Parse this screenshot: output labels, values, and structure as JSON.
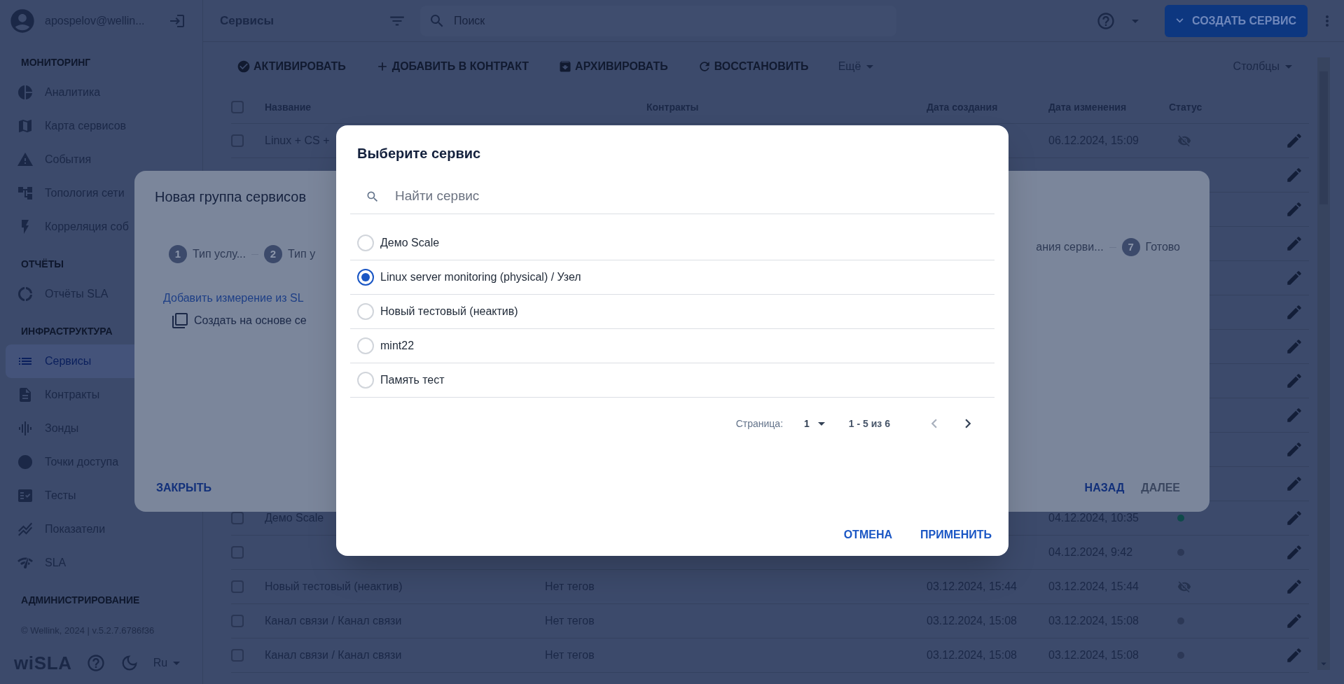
{
  "sidebar": {
    "user": "apospelov@wellin...",
    "sections": [
      {
        "title": "МОНИТОРИНГ",
        "items": [
          {
            "label": "Аналитика",
            "selected": false
          },
          {
            "label": "Карта сервисов",
            "selected": false
          },
          {
            "label": "События",
            "selected": false
          },
          {
            "label": "Топология сети",
            "selected": false
          },
          {
            "label": "Корреляция соб",
            "selected": false
          }
        ]
      },
      {
        "title": "ОТЧЁТЫ",
        "items": [
          {
            "label": "Отчёты SLA",
            "selected": false
          }
        ]
      },
      {
        "title": "ИНФРАСТРУКТУРА",
        "items": [
          {
            "label": "Сервисы",
            "selected": true
          },
          {
            "label": "Контракты",
            "selected": false
          },
          {
            "label": "Зонды",
            "selected": false
          },
          {
            "label": "Точки доступа",
            "selected": false
          },
          {
            "label": "Тесты",
            "selected": false
          },
          {
            "label": "Показатели",
            "selected": false
          },
          {
            "label": "SLA",
            "selected": false
          }
        ]
      },
      {
        "title": "АДМИНИСТРИРОВАНИЕ"
      }
    ],
    "copyright": "© Wellink, 2024 | v.5.2.7.6786f36",
    "logo": "wiSLA",
    "language": "Ru"
  },
  "topbar": {
    "title": "Сервисы",
    "search": {
      "placeholder": "Поиск"
    },
    "create_button": "СОЗДАТЬ СЕРВИС"
  },
  "toolbar": {
    "actions": [
      {
        "label": "АКТИВИРОВАТЬ",
        "disabled": true
      },
      {
        "label": "ДОБАВИТЬ В КОНТРАКТ",
        "disabled": true
      },
      {
        "label": "АРХИВИРОВАТЬ",
        "disabled": true
      },
      {
        "label": "ВОССТАНОВИТЬ",
        "disabled": true
      }
    ],
    "more": "Ещё",
    "columns": "Столбцы"
  },
  "table": {
    "select_all_checked": false,
    "columns": [
      "Название",
      "Контракты",
      "Дата создания",
      "Дата изменения",
      "Статус"
    ],
    "rows": [
      {
        "checked": false,
        "name": "Linux + CS +",
        "modified": "06.12.2024, 15:09",
        "status": {
          "kind": "inactive"
        }
      },
      {},
      {},
      {},
      {},
      {},
      {},
      {},
      {},
      {},
      {},
      {
        "checked": false,
        "name": "Демо Scale",
        "modified": "04.12.2024, 10:35",
        "status": {
          "kind": "dot",
          "color": "#0f4a4a"
        }
      },
      {
        "checked": false,
        "modified": "04.12.2024, 9:42",
        "status": {
          "kind": "dot",
          "color": "#2c3856"
        }
      },
      {
        "checked": false,
        "name": "Новый тестовый (неактив)",
        "contract": "Нет тегов",
        "created": "03.12.2024, 15:44",
        "modified": "03.12.2024, 15:44",
        "status": {
          "kind": "inactive"
        }
      },
      {
        "checked": false,
        "name": "Канал связи / Канал связи",
        "contract": "Нет тегов",
        "created": "03.12.2024, 15:08",
        "modified": "03.12.2024, 15:08",
        "status": {
          "kind": "dot",
          "color": "#2c3856"
        }
      },
      {
        "checked": false,
        "name": "Канал связи / Канал связи",
        "contract": "Нет тегов",
        "created": "03.12.2024, 15:08",
        "modified": "03.12.2024, 15:08",
        "status": {
          "kind": "dot",
          "color": "#2c3856"
        }
      }
    ]
  },
  "group_dialog": {
    "title": "Новая группа сервисов",
    "steps_left": [
      {
        "number": "1",
        "label": "Тип услу..."
      },
      {
        "number": "2",
        "label": "Тип у"
      }
    ],
    "steps_right": [
      {
        "label": "ания серви..."
      },
      {
        "number": "7",
        "label": "Готово"
      }
    ],
    "link": "Добавить измерение из SL",
    "copy_action": "Создать на основе се",
    "buttons": [
      {
        "label": "ЗАКРЫТЬ",
        "disabled": false
      },
      {
        "label": "НАЗАД",
        "disabled": false
      },
      {
        "label": "ДАЛЕЕ",
        "disabled": true
      }
    ]
  },
  "select_dialog": {
    "title": "Выберите сервис",
    "search": {
      "placeholder": "Найти сервис"
    },
    "options": [
      {
        "label": "Демо Scale",
        "selected": false
      },
      {
        "label": "Linux server monitoring (physical) / Узел",
        "selected": true
      },
      {
        "label": "Новый тестовый (неактив)",
        "selected": false
      },
      {
        "label": "mint22",
        "selected": false
      },
      {
        "label": "Память тест",
        "selected": false
      }
    ],
    "pagination": {
      "label": "Страница:",
      "page": "1",
      "range": "1 - 5 из 6",
      "prev_disabled": true,
      "next_disabled": false
    },
    "buttons": [
      "ОТМЕНА",
      "ПРИМЕНИТЬ"
    ]
  }
}
